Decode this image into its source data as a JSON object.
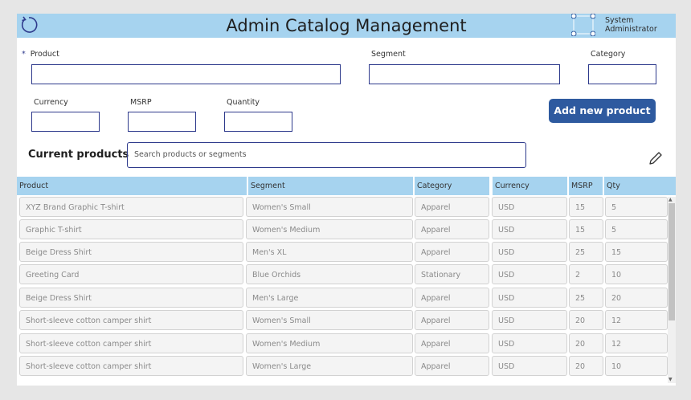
{
  "header": {
    "title": "Admin Catalog Management",
    "user_name_line1": "System",
    "user_name_line2": "Administrator"
  },
  "form": {
    "required_marker": "*",
    "product_label": "Product",
    "segment_label": "Segment",
    "category_label": "Category",
    "currency_label": "Currency",
    "msrp_label": "MSRP",
    "quantity_label": "Quantity",
    "product_value": "",
    "segment_value": "",
    "category_value": "",
    "currency_value": "",
    "msrp_value": "",
    "quantity_value": "",
    "add_button_label": "Add new product"
  },
  "products": {
    "section_label": "Current products",
    "search_placeholder": "Search products or segments",
    "columns": [
      "Product",
      "Segment",
      "Category",
      "Currency",
      "MSRP",
      "Qty"
    ],
    "rows": [
      [
        "XYZ Brand Graphic T-shirt",
        "Women's Small",
        "Apparel",
        "USD",
        "15",
        "5"
      ],
      [
        "Graphic T-shirt",
        "Women's Medium",
        "Apparel",
        "USD",
        "15",
        "5"
      ],
      [
        "Beige Dress Shirt",
        "Men's XL",
        "Apparel",
        "USD",
        "25",
        "15"
      ],
      [
        "Greeting Card",
        "Blue Orchids",
        "Stationary",
        "USD",
        "2",
        "10"
      ],
      [
        "Beige Dress Shirt",
        "Men's Large",
        "Apparel",
        "USD",
        "25",
        "20"
      ],
      [
        "Short-sleeve cotton camper shirt",
        "Women's Small",
        "Apparel",
        "USD",
        "20",
        "12"
      ],
      [
        "Short-sleeve cotton camper shirt",
        "Women's Medium",
        "Apparel",
        "USD",
        "20",
        "12"
      ],
      [
        "Short-sleeve cotton camper shirt",
        "Women's Large",
        "Apparel",
        "USD",
        "20",
        "10"
      ]
    ]
  },
  "icons": {
    "refresh": "refresh-icon",
    "user": "user-image-placeholder-icon",
    "edit": "pencil-icon"
  },
  "colors": {
    "header_bg": "#a6d3ef",
    "accent": "#2e3a8c",
    "button_bg": "#2e5a9f",
    "page_bg": "#e6e6e6"
  }
}
